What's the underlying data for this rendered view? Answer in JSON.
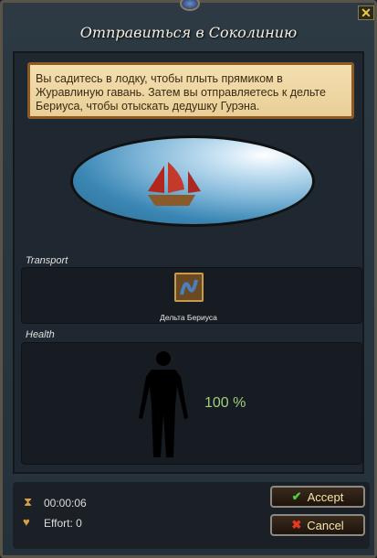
{
  "window": {
    "title": "Отправиться в Соколинию",
    "close": "✕"
  },
  "description": "Вы садитесь в лодку, чтобы плыть прямиком в Журавлиную гавань. Затем вы отправляетесь к дельте Бериуса, чтобы отыскать дедушку Гурэна.",
  "transport": {
    "label": "Transport",
    "item": "Дельта Бериуса"
  },
  "health": {
    "label": "Health",
    "value": "100 %"
  },
  "footer": {
    "timer": "00:00:06",
    "effort": "Effort: 0"
  },
  "buttons": {
    "accept": "Accept",
    "cancel": "Cancel"
  },
  "colors": {
    "accent": "#f4e6a8",
    "health": "#9fcf7f"
  }
}
